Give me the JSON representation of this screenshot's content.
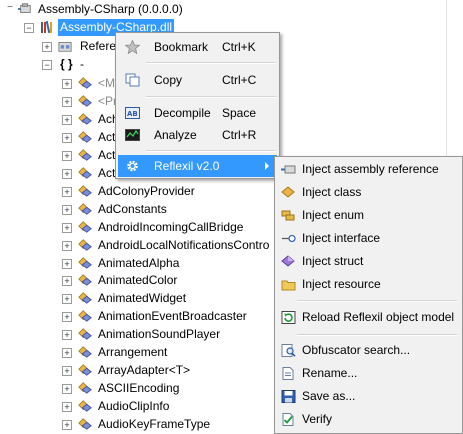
{
  "tree": {
    "root": "Assembly-CSharp (0.0.0.0)",
    "dll": "Assembly-CSharp.dll",
    "references": "References",
    "namespace": "-",
    "types": [
      {
        "label": "<Mo",
        "gray": true
      },
      {
        "label": "<Priv",
        "gray": true
      },
      {
        "label": "Achi",
        "gray": false
      },
      {
        "label": "Activ",
        "gray": false
      },
      {
        "label": "Activ",
        "gray": false
      },
      {
        "label": "Activ",
        "gray": false
      },
      {
        "label": "AdColonyProvider",
        "gray": false
      },
      {
        "label": "AdConstants",
        "gray": false
      },
      {
        "label": "AndroidIncomingCallBridge",
        "gray": false
      },
      {
        "label": "AndroidLocalNotificationsContro",
        "gray": false
      },
      {
        "label": "AnimatedAlpha",
        "gray": false
      },
      {
        "label": "AnimatedColor",
        "gray": false
      },
      {
        "label": "AnimatedWidget",
        "gray": false
      },
      {
        "label": "AnimationEventBroadcaster",
        "gray": false
      },
      {
        "label": "AnimationSoundPlayer",
        "gray": false
      },
      {
        "label": "Arrangement",
        "gray": false
      },
      {
        "label": "ArrayAdapter<T>",
        "gray": false
      },
      {
        "label": "ASCIIEncoding",
        "gray": false
      },
      {
        "label": "AudioClipInfo",
        "gray": false
      },
      {
        "label": "AudioKeyFrameType",
        "gray": false
      }
    ]
  },
  "context_menu": {
    "items": [
      {
        "label": "Bookmark",
        "shortcut": "Ctrl+K",
        "icon": "star-icon"
      },
      {
        "label": "Copy",
        "shortcut": "Ctrl+C",
        "icon": "copy-icon"
      },
      {
        "label": "Decompile",
        "shortcut": "Space",
        "icon": "decompile-icon"
      },
      {
        "label": "Analyze",
        "shortcut": "Ctrl+R",
        "icon": "analyze-icon"
      },
      {
        "label": "Reflexil v2.0",
        "shortcut": "",
        "icon": "gear-icon"
      }
    ]
  },
  "submenu": {
    "items": [
      {
        "label": "Inject assembly reference",
        "icon": "assembly-reference-icon"
      },
      {
        "label": "Inject class",
        "icon": "class-icon"
      },
      {
        "label": "Inject enum",
        "icon": "enum-icon"
      },
      {
        "label": "Inject interface",
        "icon": "interface-icon"
      },
      {
        "label": "Inject struct",
        "icon": "struct-icon"
      },
      {
        "label": "Inject resource",
        "icon": "resource-icon"
      },
      {
        "label": "Reload Reflexil object model",
        "icon": "reload-icon"
      },
      {
        "label": "Obfuscator search...",
        "icon": "search-icon"
      },
      {
        "label": "Rename...",
        "icon": "rename-icon"
      },
      {
        "label": "Save as...",
        "icon": "save-icon"
      },
      {
        "label": "Verify",
        "icon": "verify-icon"
      }
    ]
  },
  "colors": {
    "selection": "#3399ff",
    "menu_bg": "#f1f1f1",
    "menu_border": "#979797"
  }
}
